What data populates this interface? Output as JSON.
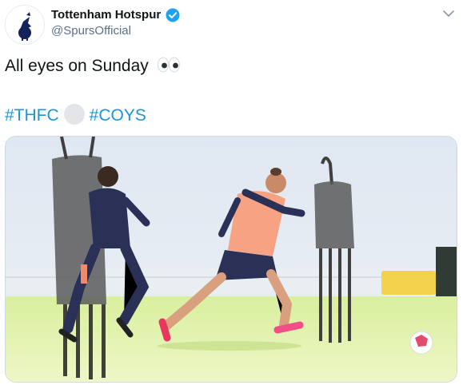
{
  "author": {
    "display_name": "Tottenham Hotspur",
    "handle": "@SpursOfficial",
    "avatar_icon": "cockerel-crest-icon",
    "verified_icon": "verified-badge-icon",
    "verified_color": "#1da1f2"
  },
  "menu": {
    "icon": "chevron-down-icon"
  },
  "tweet": {
    "text": "All eyes on Sunday",
    "emoji": "eyes-emoji",
    "hashtag1": "#THFC",
    "hashtag2": "#COYS",
    "separator_emoji": "white-circle-emoji",
    "hashtag_color": "#1b95e0"
  },
  "media": {
    "kind": "photo",
    "subject": "training-photo"
  }
}
